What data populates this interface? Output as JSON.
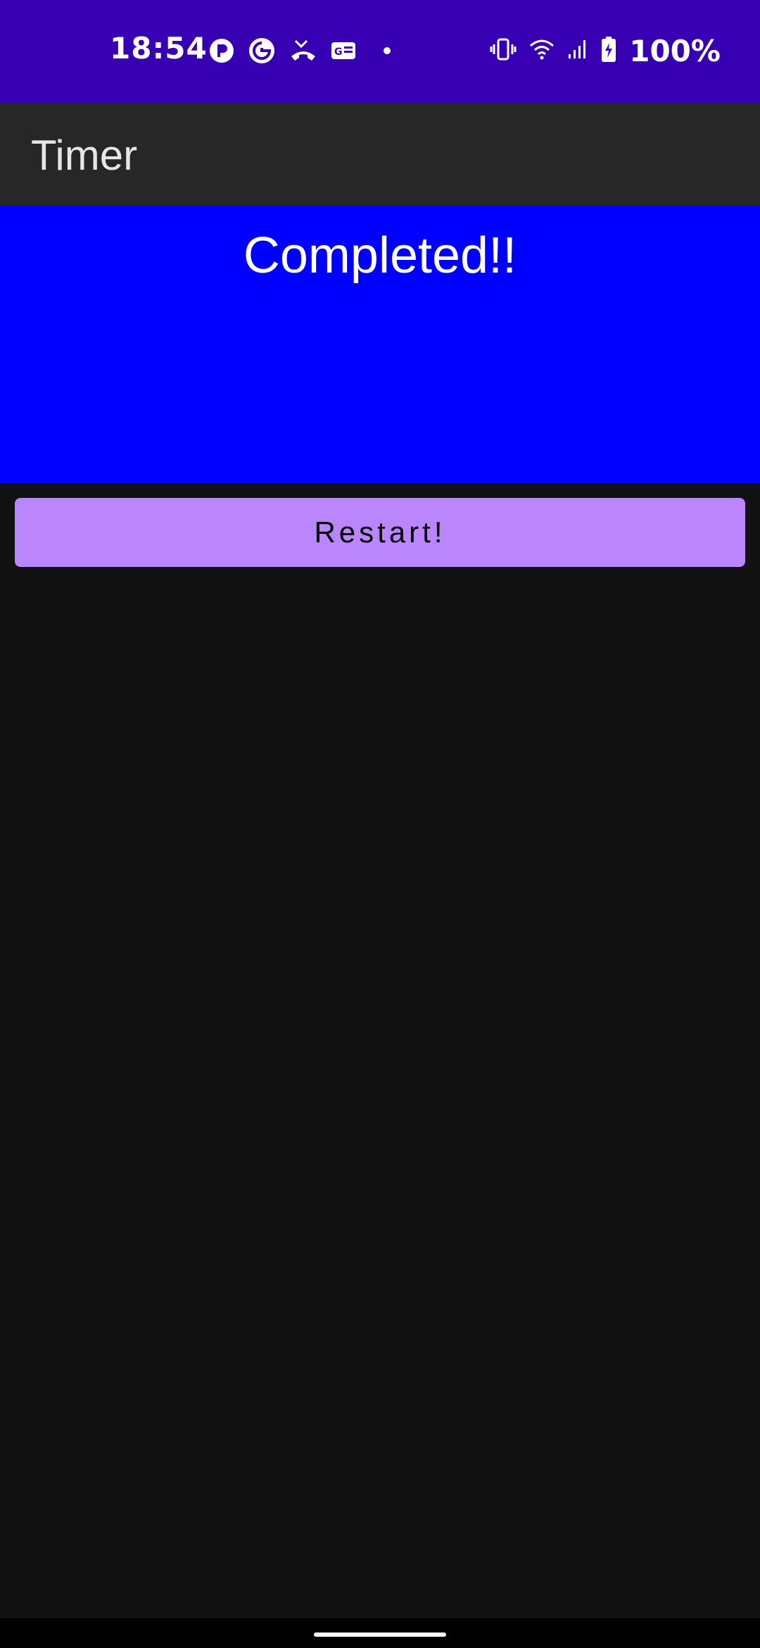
{
  "status_bar": {
    "time": "18:54",
    "battery_percent": "100%",
    "bg_color": "#3700b3",
    "left_icons": [
      "app-notification-icon",
      "g-notification-icon",
      "missed-call-icon",
      "news-icon",
      "dot-icon"
    ],
    "right_icons": [
      "vibrate-icon",
      "wifi-icon",
      "signal-icon",
      "battery-charging-icon"
    ]
  },
  "app_bar": {
    "title": "Timer",
    "bg_color": "#272727"
  },
  "main": {
    "status_text": "Completed!!",
    "panel_color": "#0000ff",
    "restart_label": "Restart!",
    "button_color": "#bb86fc"
  },
  "background_color": "#121212"
}
